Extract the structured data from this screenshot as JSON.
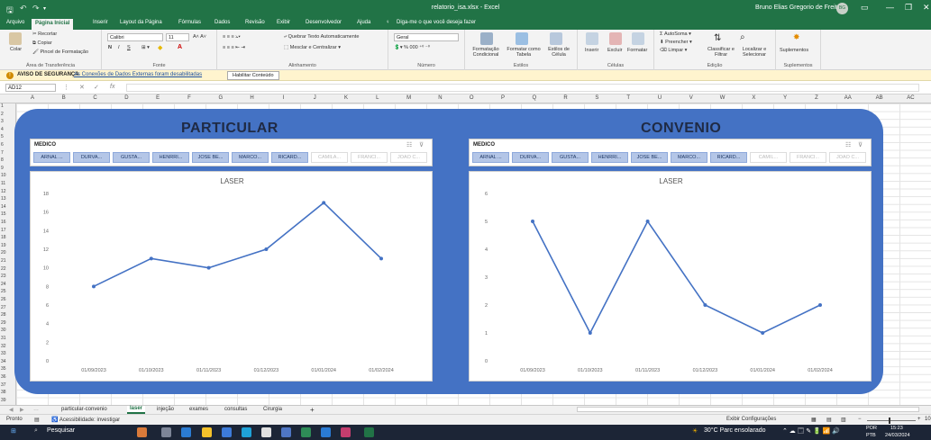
{
  "window": {
    "title": "relatorio_isa.xlsx - Excel",
    "user": "Bruno Elias Gregorio de Freitas",
    "user_initials": "BG",
    "brand_color": "#217346"
  },
  "menu": {
    "tabs": [
      "Arquivo",
      "Página Inicial",
      "Inserir",
      "Layout da Página",
      "Fórmulas",
      "Dados",
      "Revisão",
      "Exibir",
      "Desenvolvedor",
      "Ajuda"
    ],
    "active_index": 1,
    "tell_me": "Diga-me o que você deseja fazer"
  },
  "ribbon": {
    "clipboard": {
      "paste": "Colar",
      "cut": "Recortar",
      "copy": "Copiar",
      "format_painter": "Pincel de Formatação",
      "label": "Área de Transferência"
    },
    "font": {
      "name": "Calibri",
      "size": "11",
      "label": "Fonte",
      "bold": "N",
      "italic": "I",
      "underline": "S"
    },
    "alignment": {
      "wrap": "Quebrar Texto Automaticamente",
      "merge": "Mesclar e Centralizar",
      "label": "Alinhamento"
    },
    "number": {
      "format": "Geral",
      "label": "Número"
    },
    "styles": {
      "conditional": "Formatação Condicional",
      "as_table": "Formatar como Tabela",
      "cell_styles": "Estilos de Célula",
      "label": "Estilos"
    },
    "cells": {
      "insert": "Inserir",
      "delete": "Excluir",
      "format": "Formatar",
      "label": "Células"
    },
    "editing": {
      "autosum": "AutoSoma",
      "fill": "Preencher",
      "clear": "Limpar",
      "sort": "Classificar e Filtrar",
      "find": "Localizar e Selecionar",
      "label": "Edição"
    },
    "addins": {
      "label": "Suplementos",
      "button": "Suplementos"
    }
  },
  "security_bar": {
    "title": "AVISO DE SEGURANÇA",
    "message": "As Conexões de Dados Externas foram desabilitadas",
    "button": "Habilitar Conteúdo"
  },
  "formula_bar": {
    "name_box": "AD12",
    "fx": "fx",
    "value": ""
  },
  "grid": {
    "columns": [
      "A",
      "B",
      "C",
      "D",
      "E",
      "F",
      "G",
      "H",
      "I",
      "J",
      "K",
      "L",
      "M",
      "N",
      "O",
      "P",
      "Q",
      "R",
      "S",
      "T",
      "U",
      "V",
      "W",
      "X",
      "Y",
      "Z",
      "AA",
      "AB",
      "AC"
    ],
    "rows": [
      "1",
      "2",
      "3",
      "4",
      "5",
      "6",
      "7",
      "8",
      "9",
      "10",
      "11",
      "12",
      "13",
      "14",
      "15",
      "16",
      "17",
      "18",
      "19",
      "20",
      "21",
      "22",
      "23",
      "24",
      "25",
      "26",
      "27",
      "28",
      "29",
      "30",
      "31",
      "32",
      "33",
      "34",
      "35",
      "36",
      "37",
      "38",
      "39"
    ]
  },
  "dashboard": {
    "panel_color": "#4472c4",
    "left": {
      "title": "PARTICULAR",
      "slicer_header": "MEDICO",
      "slicer_items": [
        "ARNAL ...",
        "DURVA...",
        "GUSTA...",
        "HENRRI...",
        "JOSE BE...",
        "MARCO...",
        "RICARD...",
        "CAMILA...",
        "FRANCI...",
        "JOAO C..."
      ],
      "slicer_active": [
        true,
        true,
        true,
        true,
        true,
        true,
        true,
        false,
        false,
        false
      ]
    },
    "right": {
      "title": "CONVENIO",
      "slicer_header": "MEDICO",
      "slicer_items": [
        "ARNAL ...",
        "DURVA...",
        "GUSTA...",
        "HENRRI...",
        "JOSE BE...",
        "MARCO...",
        "RICARD...",
        "CAMIL...",
        "FRANCI...",
        "JOAO C..."
      ],
      "slicer_active": [
        true,
        true,
        true,
        true,
        true,
        true,
        true,
        false,
        false,
        false
      ]
    }
  },
  "chart_data": [
    {
      "type": "line",
      "title": "LASER",
      "categories": [
        "01/09/2023",
        "01/10/2023",
        "01/11/2023",
        "01/12/2023",
        "01/01/2024",
        "01/02/2024"
      ],
      "values": [
        8,
        11,
        10,
        12,
        17,
        11
      ],
      "yticks": [
        0,
        2,
        4,
        6,
        8,
        10,
        12,
        14,
        16,
        18
      ],
      "ylim": [
        0,
        18
      ],
      "color": "#4472c4",
      "grid": false
    },
    {
      "type": "line",
      "title": "LASER",
      "categories": [
        "01/09/2023",
        "01/10/2023",
        "01/11/2023",
        "01/12/2023",
        "01/01/2024",
        "01/02/2024"
      ],
      "values": [
        5,
        1,
        5,
        2,
        1,
        2
      ],
      "yticks": [
        0,
        1,
        2,
        3,
        4,
        5,
        6
      ],
      "ylim": [
        0,
        6
      ],
      "color": "#4472c4",
      "grid": false
    }
  ],
  "sheet_tabs": {
    "tabs": [
      "particular-convenio",
      "laser",
      "injeção",
      "exames",
      "consultas",
      "Cirurgia"
    ],
    "active_index": 1,
    "add": "+"
  },
  "status_bar": {
    "ready": "Pronto",
    "accessibility": "Acessibilidade: investigar",
    "display_settings": "Exibir Configurações",
    "zoom": "10"
  },
  "taskbar": {
    "search": "Pesquisar",
    "weather": "30°C Parc ensolarado",
    "lang": "POR",
    "lang2": "PTB",
    "time": "15:23",
    "date": "24/03/2024"
  }
}
